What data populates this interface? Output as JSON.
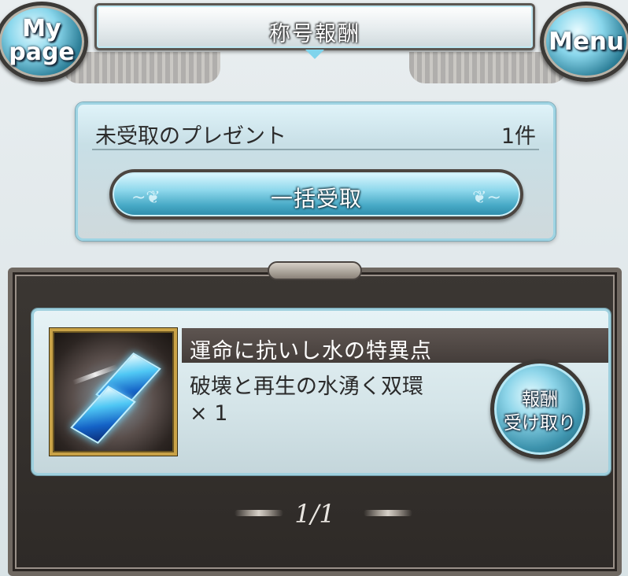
{
  "header": {
    "title": "称号報酬",
    "mypage_line1": "My",
    "mypage_line2": "page",
    "menu_label": "Menu"
  },
  "present": {
    "label": "未受取のプレゼント",
    "count": "1件",
    "bulk_button_label": "一括受取"
  },
  "rewards": [
    {
      "title": "運命に抗いし水の特異点",
      "item_name": "破壊と再生の水湧く双環",
      "quantity": "× 1",
      "claim_line1": "報酬",
      "claim_line2": "受け取り",
      "icon": "blue-crystal-ring-icon"
    }
  ],
  "pager": {
    "text": "1/1"
  }
}
